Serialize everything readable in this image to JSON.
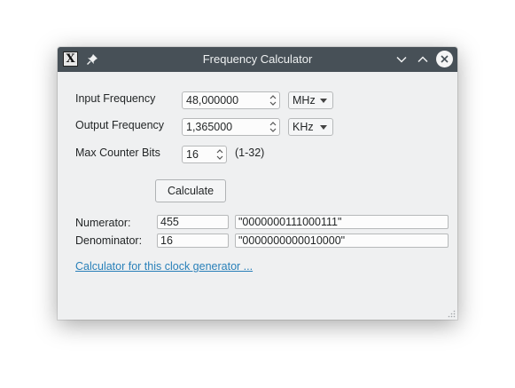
{
  "window": {
    "title": "Frequency Calculator",
    "app_icon_glyph": "X",
    "icons": {
      "app": "app-icon",
      "pin": "pin-icon",
      "minimize": "chevron-down-icon",
      "maximize": "chevron-up-icon",
      "close": "close-icon"
    },
    "colors": {
      "titlebar": "#475057",
      "window_bg": "#eff0f1",
      "link": "#2980b9"
    }
  },
  "form": {
    "input_frequency": {
      "label": "Input Frequency",
      "value": "48,000000",
      "unit": "MHz"
    },
    "output_frequency": {
      "label": "Output Frequency",
      "value": "1,365000",
      "unit": "KHz"
    },
    "max_counter_bits": {
      "label": "Max Counter Bits",
      "value": "16",
      "range_hint": "(1-32)"
    },
    "calculate_label": "Calculate"
  },
  "results": {
    "numerator": {
      "label": "Numerator:",
      "value": "455",
      "binary": "\"0000000111000111\""
    },
    "denominator": {
      "label": "Denominator:",
      "value": "16",
      "binary": "\"0000000000010000\""
    }
  },
  "link_text": "Calculator for this clock generator ..."
}
